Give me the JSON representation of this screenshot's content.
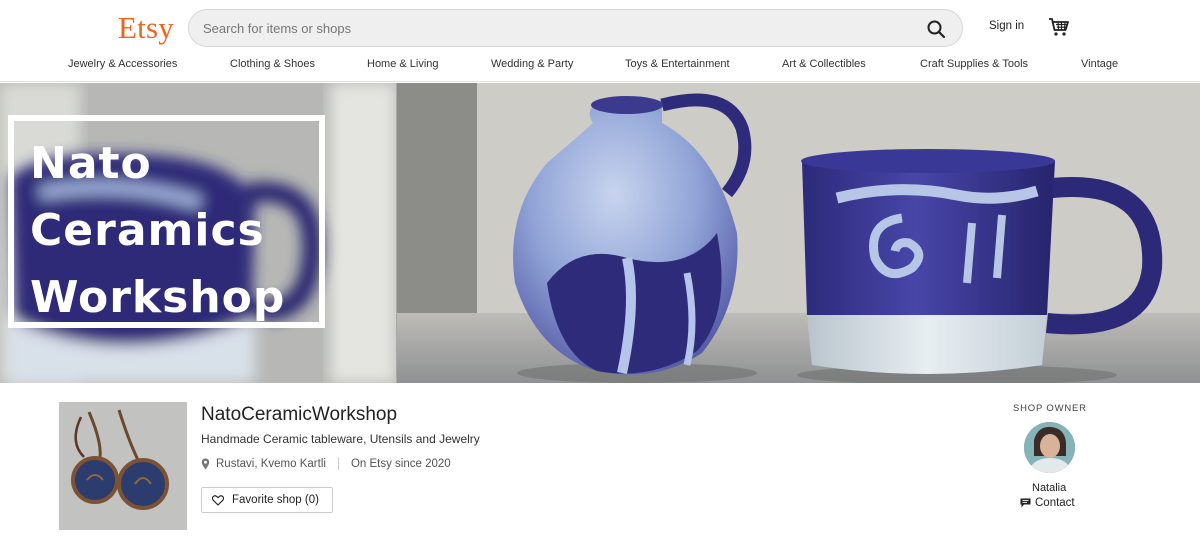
{
  "header": {
    "logo": "Etsy",
    "search_placeholder": "Search for items or shops",
    "sign_in": "Sign in"
  },
  "categories": [
    "Jewelry & Accessories",
    "Clothing & Shoes",
    "Home & Living",
    "Wedding & Party",
    "Toys & Entertainment",
    "Art & Collectibles",
    "Craft Supplies & Tools",
    "Vintage"
  ],
  "banner": {
    "title_lines": [
      "Nato",
      "Ceramics",
      "Workshop"
    ]
  },
  "shop": {
    "name": "NatoCeramicWorkshop",
    "tagline": "Handmade Ceramic tableware, Utensils and Jewelry",
    "location": "Rustavi, Kvemo Kartli",
    "since": "On Etsy since 2020",
    "favorite_label": "Favorite shop (0)"
  },
  "owner": {
    "label": "SHOP OWNER",
    "name": "Natalia",
    "contact_label": "Contact"
  },
  "colors": {
    "brand": "#f1641e",
    "glaze_blue": "#3c3a8c",
    "glaze_light": "#b7c6e6"
  },
  "icons": [
    "search-icon",
    "cart-icon",
    "pin-icon",
    "heart-icon",
    "message-icon"
  ]
}
